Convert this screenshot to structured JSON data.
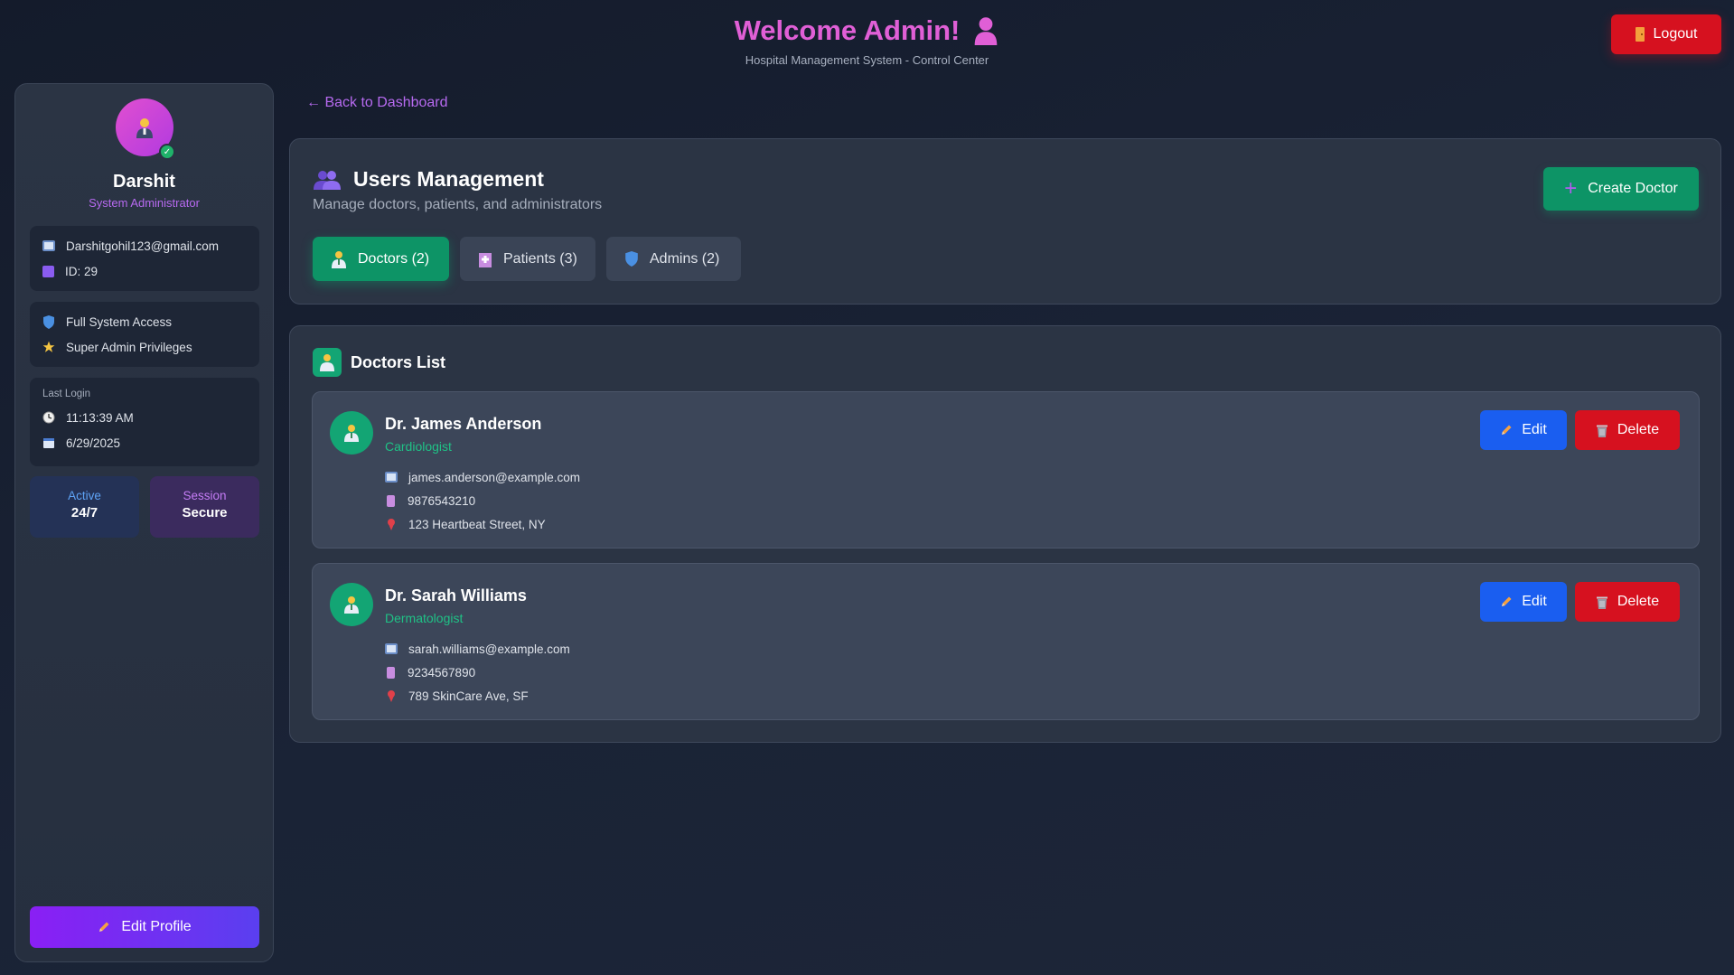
{
  "header": {
    "title": "Welcome Admin!",
    "subtitle": "Hospital Management System - Control Center",
    "logout_label": "Logout"
  },
  "sidebar": {
    "name": "Darshit",
    "role": "System Administrator",
    "email": "Darshitgohil123@gmail.com",
    "id": "ID: 29",
    "permissions": [
      "Full System Access",
      "Super Admin Privileges"
    ],
    "last_login_label": "Last Login",
    "last_login_time": "11:13:39 AM",
    "last_login_date": "6/29/2025",
    "stats": [
      {
        "label": "Active",
        "value": "24/7"
      },
      {
        "label": "Session",
        "value": "Secure"
      }
    ],
    "edit_profile_label": "Edit Profile"
  },
  "main": {
    "back_link": "← Back to Dashboard",
    "title": "Users Management",
    "subtitle": "Manage doctors, patients, and administrators",
    "create_button": "Create Doctor",
    "tabs": [
      {
        "label": "Doctors (2)"
      },
      {
        "label": "Patients (3)"
      },
      {
        "label": "Admins (2)"
      }
    ],
    "list_title": "Doctors List",
    "doctors": [
      {
        "name": "Dr. James Anderson",
        "specialty": "Cardiologist",
        "email": "james.anderson@example.com",
        "phone": "9876543210",
        "address": "123 Heartbeat Street, NY"
      },
      {
        "name": "Dr. Sarah Williams",
        "specialty": "Dermatologist",
        "email": "sarah.williams@example.com",
        "phone": "9234567890",
        "address": "789 SkinCare Ave, SF"
      }
    ],
    "edit_label": "Edit",
    "delete_label": "Delete"
  },
  "colors": {
    "accent_pink": "#e05fd6",
    "accent_purple": "#b76af0",
    "success_green": "#0d9466",
    "primary_blue": "#1a5ef0",
    "danger_red": "#d6111f"
  }
}
